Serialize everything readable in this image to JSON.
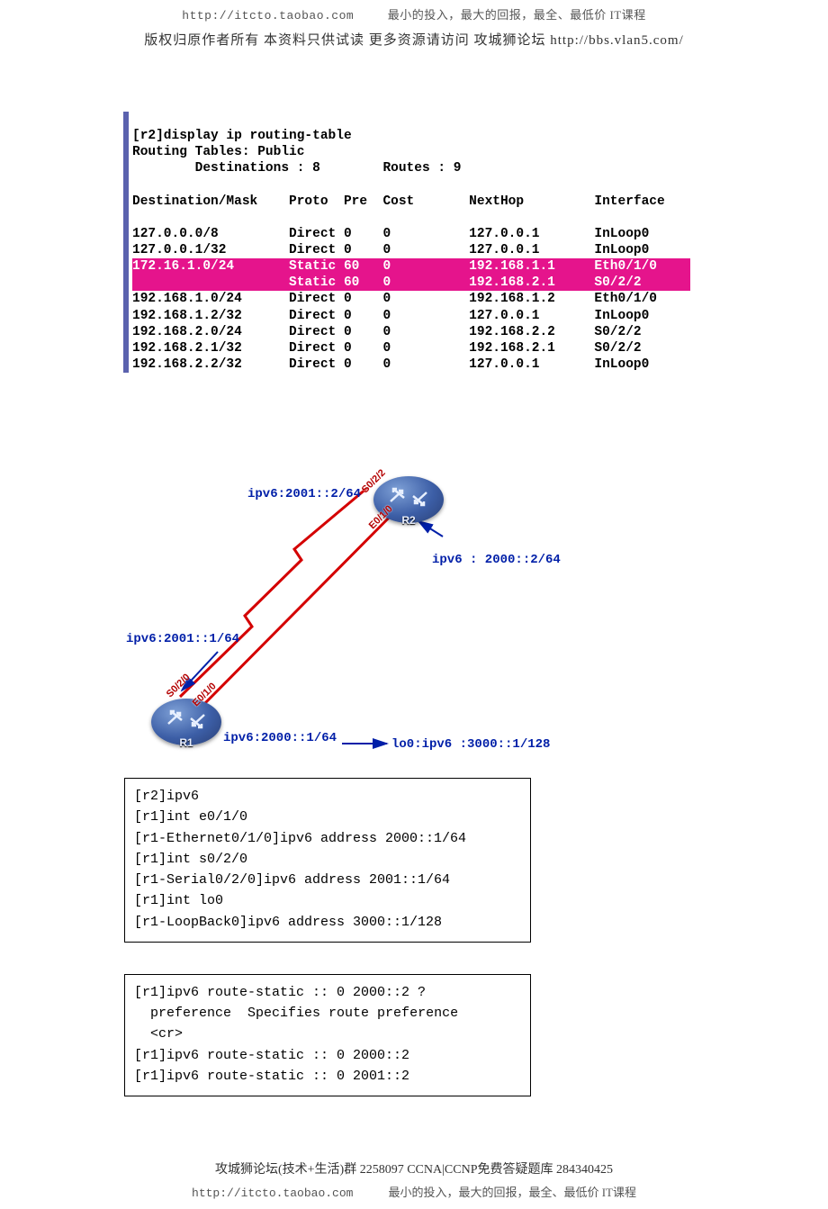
{
  "header": {
    "top_left_url": "http://itcto.taobao.com",
    "top_right": "最小的投入，最大的回报，最全、最低价 IT课程",
    "line2": "版权归原作者所有 本资料只供试读 更多资源请访问 攻城狮论坛 http://bbs.vlan5.com/"
  },
  "routing_table": {
    "cmd": "[r2]display ip routing-table",
    "title": "Routing Tables: Public",
    "summary": "        Destinations : 8        Routes : 9",
    "header_row": "Destination/Mask    Proto  Pre  Cost       NextHop         Interface",
    "rows": [
      {
        "text": "127.0.0.0/8         Direct 0    0          127.0.0.1       InLoop0",
        "hl": false
      },
      {
        "text": "127.0.0.1/32        Direct 0    0          127.0.0.1       InLoop0",
        "hl": false
      },
      {
        "text": "172.16.1.0/24       Static 60   0          192.168.1.1     Eth0/1/0",
        "hl": true
      },
      {
        "text": "                    Static 60   0          192.168.2.1     S0/2/2",
        "hl": true
      },
      {
        "text": "192.168.1.0/24      Direct 0    0          192.168.1.2     Eth0/1/0",
        "hl": false
      },
      {
        "text": "192.168.1.2/32      Direct 0    0          127.0.0.1       InLoop0",
        "hl": false
      },
      {
        "text": "192.168.2.0/24      Direct 0    0          192.168.2.2     S0/2/2",
        "hl": false
      },
      {
        "text": "192.168.2.1/32      Direct 0    0          192.168.2.1     S0/2/2",
        "hl": false
      },
      {
        "text": "192.168.2.2/32      Direct 0    0          127.0.0.1       InLoop0",
        "hl": false
      }
    ]
  },
  "diagram": {
    "r1_name": "R1",
    "r2_name": "R2",
    "labels": {
      "r2_s": "ipv6:2001::2/64",
      "r2_e": "ipv6 : 2000::2/64",
      "r1_s": "ipv6:2001::1/64",
      "r1_e": "ipv6:2000::1/64",
      "r1_lo": "lo0:ipv6 :3000::1/128",
      "if_s022_top": "S0/2/2",
      "if_e010_top": "E0/1/0",
      "if_s020_bot": "S0/2/0",
      "if_e010_bot": "E0/1/0"
    }
  },
  "code_box1": "[r2]ipv6\n[r1]int e0/1/0\n[r1-Ethernet0/1/0]ipv6 address 2000::1/64\n[r1]int s0/2/0\n[r1-Serial0/2/0]ipv6 address 2001::1/64\n[r1]int lo0\n[r1-LoopBack0]ipv6 address 3000::1/128",
  "code_box2": "[r1]ipv6 route-static :: 0 2000::2 ?\n  preference  Specifies route preference\n  <cr>\n[r1]ipv6 route-static :: 0 2000::2\n[r1]ipv6 route-static :: 0 2001::2",
  "footer": {
    "line1": "攻城狮论坛(技术+生活)群 2258097 CCNA|CCNP免费答疑题库 284340425",
    "line2_left": "http://itcto.taobao.com",
    "line2_right": "最小的投入，最大的回报，最全、最低价 IT课程"
  }
}
